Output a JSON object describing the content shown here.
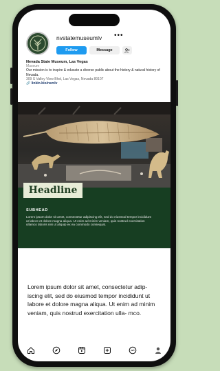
{
  "profile": {
    "username": "nvstatemuseumlv",
    "more_icon": "more-dots-icon",
    "buttons": {
      "follow": "Follow",
      "message": "Message",
      "add_user_icon": "add-person-icon"
    },
    "bio": {
      "name": "Nevada State Museum, Las Vegas",
      "category": "Museum",
      "description": "Our mission is to inspire & educate a diverse public about the history & natural history of Nevada.",
      "address": "309 S Valley View Blvd, Las Vegas, Nevada 89107",
      "link": "linkin.bio/nsmlv"
    }
  },
  "post": {
    "headline": "Headline",
    "subhead": "SUBHEAD",
    "body": "Lorem ipsum dolor sit amet, consectetur adipiscing elit, sed do eiusmod tempor incididunt ut labore et dolore magna aliqua. Ut enim ad minim veniam, quis nostrud exercitation ullamco laboris nisi ut aliquip ex ea commodo consequat."
  },
  "caption": "Lorem ipsum dolor sit amet, consectetur adip- iscing elit, sed do eiusmod tempor incididunt ut labore et dolore magna aliqua. Ut enim ad minim veniam, quis nostrud exercitation ulla- mco.",
  "bottom_nav": [
    "home-icon",
    "explore-icon",
    "reels-icon",
    "create-icon",
    "activity-icon",
    "profile-icon"
  ],
  "colors": {
    "background": "#c7ddb9",
    "follow_button": "#1e9bf0",
    "post_green": "#173e22",
    "headline_box": "#e7ecd7"
  }
}
